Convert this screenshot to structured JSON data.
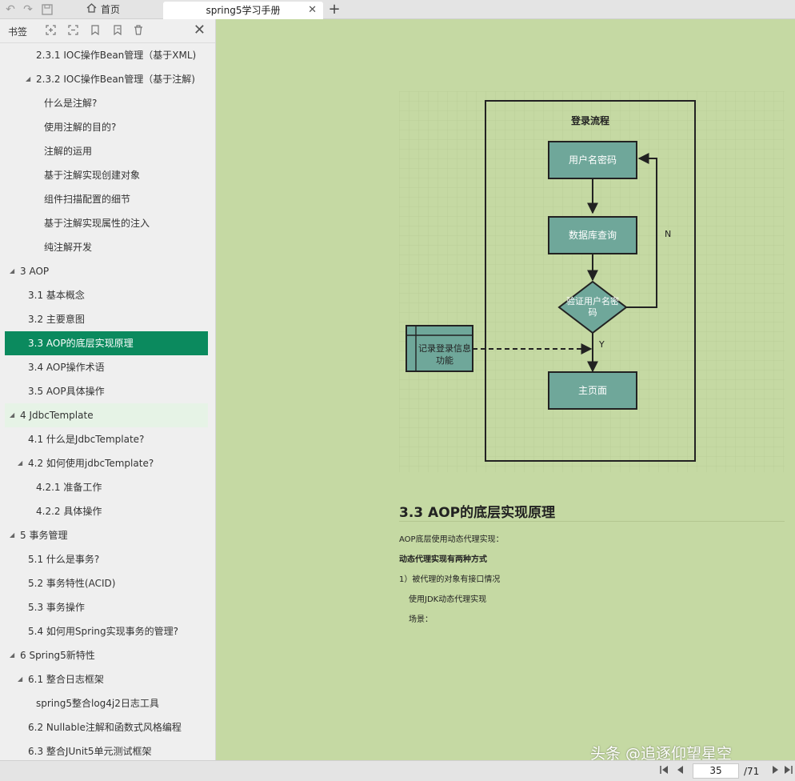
{
  "tabs": {
    "home_label": "首页",
    "doc_label": "spring5学习手册"
  },
  "sidebar": {
    "title": "书签",
    "items": [
      {
        "label": "2.3.1 IOC操作Bean管理（基于XML)",
        "level": 3,
        "arrow": false,
        "state": ""
      },
      {
        "label": "2.3.2 IOC操作Bean管理（基于注解)",
        "level": 3,
        "arrow": true,
        "state": ""
      },
      {
        "label": "什么是注解?",
        "level": 4,
        "arrow": false,
        "state": ""
      },
      {
        "label": "使用注解的目的?",
        "level": 4,
        "arrow": false,
        "state": ""
      },
      {
        "label": "注解的运用",
        "level": 4,
        "arrow": false,
        "state": ""
      },
      {
        "label": "基于注解实现创建对象",
        "level": 4,
        "arrow": false,
        "state": ""
      },
      {
        "label": "组件扫描配置的细节",
        "level": 4,
        "arrow": false,
        "state": ""
      },
      {
        "label": "基于注解实现属性的注入",
        "level": 4,
        "arrow": false,
        "state": ""
      },
      {
        "label": "纯注解开发",
        "level": 4,
        "arrow": false,
        "state": ""
      },
      {
        "label": "3 AOP",
        "level": 1,
        "arrow": true,
        "state": ""
      },
      {
        "label": "3.1 基本概念",
        "level": 2,
        "arrow": false,
        "state": ""
      },
      {
        "label": "3.2 主要意图",
        "level": 2,
        "arrow": false,
        "state": ""
      },
      {
        "label": "3.3 AOP的底层实现原理",
        "level": 2,
        "arrow": false,
        "state": "active"
      },
      {
        "label": "3.4 AOP操作术语",
        "level": 2,
        "arrow": false,
        "state": ""
      },
      {
        "label": "3.5 AOP具体操作",
        "level": 2,
        "arrow": false,
        "state": ""
      },
      {
        "label": "4 JdbcTemplate",
        "level": 1,
        "arrow": true,
        "state": "hover"
      },
      {
        "label": "4.1 什么是JdbcTemplate?",
        "level": 2,
        "arrow": false,
        "state": ""
      },
      {
        "label": "4.2 如何使用jdbcTemplate?",
        "level": 2,
        "arrow": true,
        "state": ""
      },
      {
        "label": "4.2.1 准备工作",
        "level": 3,
        "arrow": false,
        "state": ""
      },
      {
        "label": "4.2.2 具体操作",
        "level": 3,
        "arrow": false,
        "state": ""
      },
      {
        "label": "5 事务管理",
        "level": 1,
        "arrow": true,
        "state": ""
      },
      {
        "label": "5.1 什么是事务?",
        "level": 2,
        "arrow": false,
        "state": ""
      },
      {
        "label": "5.2 事务特性(ACID)",
        "level": 2,
        "arrow": false,
        "state": ""
      },
      {
        "label": "5.3 事务操作",
        "level": 2,
        "arrow": false,
        "state": ""
      },
      {
        "label": "5.4 如何用Spring实现事务的管理?",
        "level": 2,
        "arrow": false,
        "state": ""
      },
      {
        "label": "6 Spring5新特性",
        "level": 1,
        "arrow": true,
        "state": ""
      },
      {
        "label": "6.1 整合日志框架",
        "level": 2,
        "arrow": true,
        "state": ""
      },
      {
        "label": "spring5整合log4j2日志工具",
        "level": 3,
        "arrow": false,
        "state": ""
      },
      {
        "label": "6.2 Nullable注解和函数式风格编程",
        "level": 2,
        "arrow": false,
        "state": ""
      },
      {
        "label": "6.3 整合JUnit5单元测试框架",
        "level": 2,
        "arrow": false,
        "state": ""
      }
    ]
  },
  "diagram": {
    "title": "登录流程",
    "box_user": "用户名密码",
    "box_db": "数据库查询",
    "box_verify": "验证用户名密码",
    "box_main": "主页面",
    "box_log": "记录登录信息功能",
    "label_n": "N",
    "label_y": "Y"
  },
  "document": {
    "section_title": "3.3 AOP的底层实现原理",
    "p1": "AOP底层使用动态代理实现：",
    "p2": "动态代理实现有两种方式",
    "p3": "1）被代理的对象有接口情况",
    "p4": "使用JDK动态代理实现",
    "p5": "场景："
  },
  "pager": {
    "current": "35",
    "total": "/71"
  },
  "watermark": "头条 @追逐仰望星空",
  "colors": {
    "page_bg": "#c5d9a3",
    "active_item": "#0b8a5e",
    "box_fill": "#6fa79a"
  }
}
